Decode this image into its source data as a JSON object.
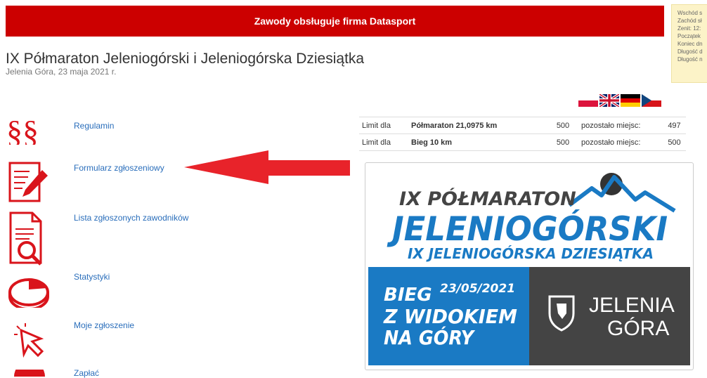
{
  "banner": {
    "text": "Zawody obsługuje firma Datasport"
  },
  "sun_info": {
    "lines": [
      "Wschód s",
      "Zachód sł",
      "Zenit: 12:",
      "Początek",
      "Koniec dn",
      "Długość d",
      "Długość n"
    ]
  },
  "event": {
    "title": "IX Półmaraton Jeleniogórski i Jeleniogórska Dziesiątka",
    "subtitle": "Jelenia Góra, 23 maja 2021 r."
  },
  "languages": [
    {
      "code": "pl",
      "icon": "flag-pl-icon"
    },
    {
      "code": "en",
      "icon": "flag-gb-icon"
    },
    {
      "code": "de",
      "icon": "flag-de-icon"
    },
    {
      "code": "cz",
      "icon": "flag-cz-icon"
    }
  ],
  "menu": {
    "regulamin": "Regulamin",
    "formularz": "Formularz zgłoszeniowy",
    "lista": "Lista zgłoszonych zawodników",
    "statystyki": "Statystyki",
    "moje": "Moje zgłoszenie",
    "zaplac": "Zapłać"
  },
  "limits": [
    {
      "label": "Limit dla",
      "name": "Półmaraton 21,0975 km",
      "limit": "500",
      "remaining_label": "pozostało miejsc:",
      "remaining": "497"
    },
    {
      "label": "Limit dla",
      "name": "Bieg 10 km",
      "limit": "500",
      "remaining_label": "pozostało miejsc:",
      "remaining": "500"
    }
  ],
  "poster": {
    "line1": "IX PÓŁMARATON",
    "line2": "JELENIOGÓRSKI",
    "line3": "IX JELENIOGÓRSKA DZIESIĄTKA",
    "bieg": "BIEG",
    "date": "23/05/2021",
    "z_widokiem": "Z WIDOKIEM",
    "na_gory": "NA GÓRY",
    "city1": "JELENIA",
    "city2": "GÓRA",
    "colors": {
      "blue": "#1a7ac4",
      "dark": "#444444",
      "red": "#e1262d"
    }
  }
}
